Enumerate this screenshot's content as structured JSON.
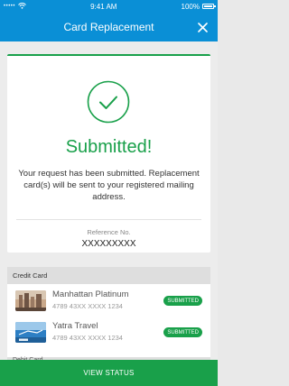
{
  "status_bar": {
    "carrier_signal": "•••••",
    "time": "9:41 AM",
    "battery": "100%"
  },
  "header": {
    "title": "Card Replacement",
    "close_icon": "close-icon"
  },
  "confirmation": {
    "icon": "check-circle-icon",
    "title": "Submitted!",
    "message": "Your request has been submitted. Replacement card(s) will be sent to your registered mailing address.",
    "reference_label": "Reference No.",
    "reference_value": "XXXXXXXXX"
  },
  "credit_card_section": {
    "title": "Credit Card",
    "items": [
      {
        "name": "Manhattan Platinum",
        "number": "4789 43XX XXXX 1234",
        "status": "SUBMITTED",
        "thumb_icon": "card-thumbnail-icon"
      },
      {
        "name": "Yatra Travel",
        "number": "4789 43XX XXXX 1234",
        "status": "SUBMITTED",
        "thumb_icon": "card-thumbnail-icon"
      }
    ]
  },
  "next_section_title": "Debit Card",
  "footer": {
    "button_label": "VIEW STATUS"
  },
  "colors": {
    "brand_blue": "#0a8fd6",
    "success_green": "#19a04a"
  }
}
